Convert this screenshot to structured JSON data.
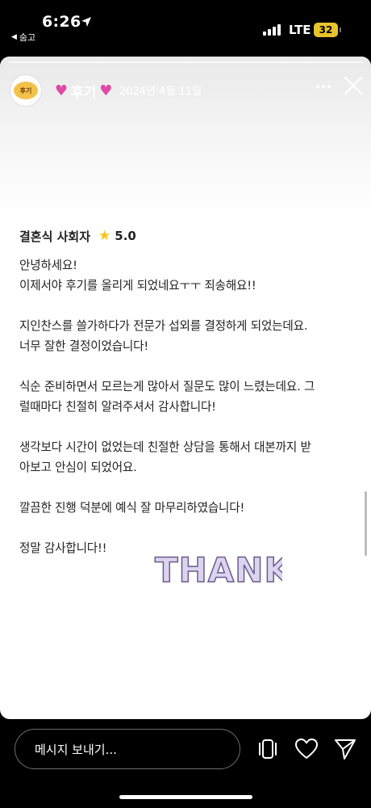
{
  "status_bar": {
    "time": "6:26",
    "back_app": "숨고",
    "network": "LTE",
    "battery": "32"
  },
  "story": {
    "title": "후기",
    "date": "2024년 4월 11일",
    "avatar_text": "후기"
  },
  "review": {
    "role": "결혼식 사회자",
    "rating": "5.0",
    "lines": [
      "안녕하세요!",
      "이제서야 후기를 올리게 되었네요ㅜㅜ 죄송해요!!",
      "",
      "지인찬스를 쓸가하다가 전문가 섭외를 결정하게 되었는데요.",
      "너무 잘한 결정이었습니다!",
      "",
      "식순 준비하면서 모르는게 많아서 질문도 많이 느렸는데요. 그",
      "럴때마다 친절히 알려주셔서 감사합니다!",
      "",
      "생각보다 시간이 없었는데 친절한 상담을 통해서 대본까지 받",
      "아보고 안심이 되었어요.",
      "",
      "깔끔한 진행 덕분에 예식 잘 마무리하였습니다!",
      "",
      "정말 감사합니다!!"
    ]
  },
  "sticker": {
    "text": "THANK"
  },
  "bottom_bar": {
    "message_placeholder": "메시지 보내기..."
  },
  "icons": {
    "location": "location-arrow-icon",
    "more": "more-dots-icon",
    "close": "close-icon",
    "reshare": "reshare-icon",
    "like": "heart-icon",
    "send": "send-icon"
  },
  "colors": {
    "battery": "#e8c32e",
    "star": "#f5c518",
    "title_heart": "#e04aa6"
  }
}
